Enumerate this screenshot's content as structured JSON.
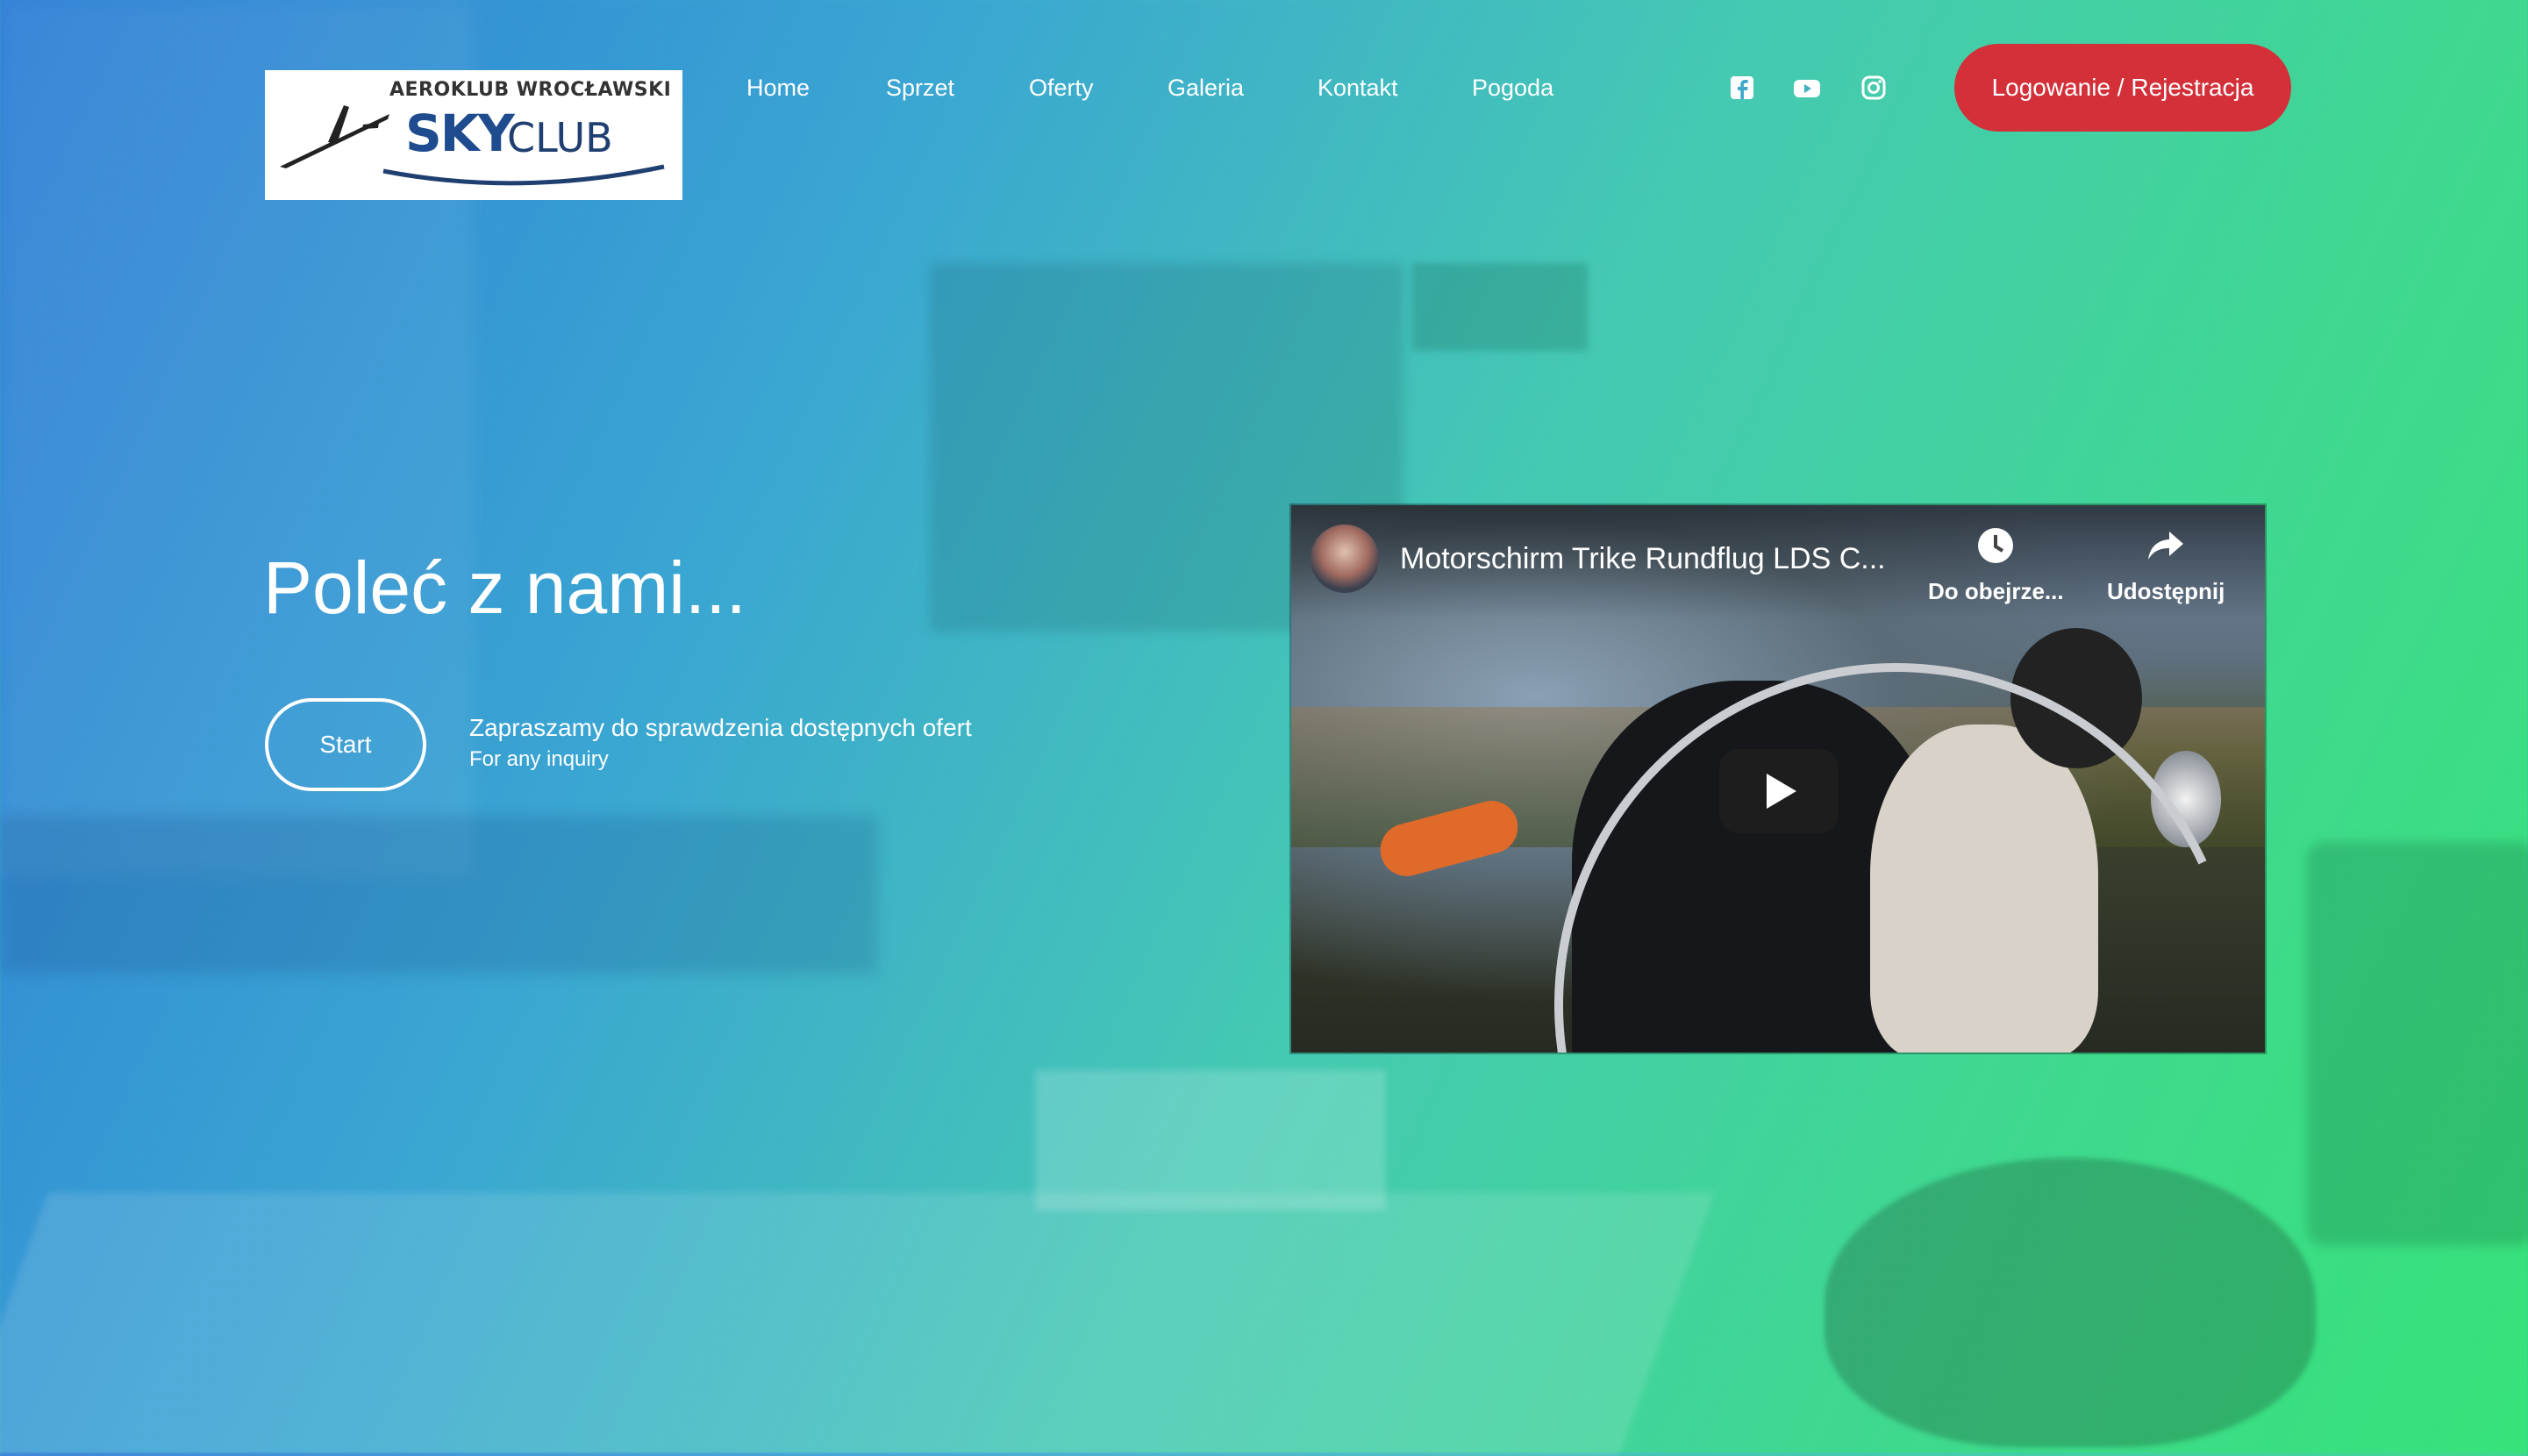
{
  "logo": {
    "line1": "AEROKLUB WROCŁAWSKI",
    "sky": "SKY",
    "club": "CLUB"
  },
  "nav": {
    "items": [
      "Home",
      "Sprzet",
      "Oferty",
      "Galeria",
      "Kontakt",
      "Pogoda"
    ]
  },
  "social": [
    "facebook-icon",
    "youtube-icon",
    "instagram-icon"
  ],
  "header": {
    "login_label": "Logowanie / Rejestracja"
  },
  "hero": {
    "title": "Poleć z nami...",
    "start_label": "Start",
    "text_main": "Zapraszamy do sprawdzenia dostępnych ofert",
    "text_sub": "For any inquiry"
  },
  "video": {
    "title": "Motorschirm Trike Rundflug LDS C...",
    "watch_later": "Do obejrze...",
    "share": "Udostępnij"
  },
  "colors": {
    "gradient_start": "#2f7fd6",
    "gradient_end": "#37e27a",
    "login_button": "#d3303a",
    "logo_blue": "#1f4c8f"
  }
}
